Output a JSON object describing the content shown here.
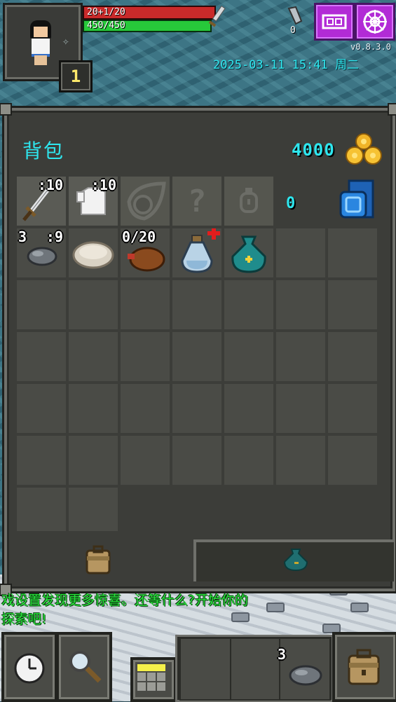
{
  "hud": {
    "hp_text": "20+1/20",
    "hp_fraction": 1.0,
    "exp_text": "450/450",
    "exp_fraction": 1.0,
    "level": "1",
    "keys": "0",
    "version": "v0.8.3.0",
    "datetime": "2025-03-11 15:41 周二",
    "icons": [
      "hero-portrait",
      "sword-icon",
      "key-icon",
      "journal-icon",
      "settings-icon"
    ],
    "colors": {
      "hp": "#c92a2a",
      "exp": "#27c93a",
      "accent": "#2ee6ee",
      "menu_button": "#b22bd6"
    }
  },
  "backpack": {
    "title": "背包",
    "gold": "4000",
    "equipment": [
      {
        "name": "sword-icon",
        "count": ":10"
      },
      {
        "name": "cloth-armor-icon",
        "count": ":10"
      },
      {
        "name": "empty-artifact-slot-icon",
        "count": ""
      },
      {
        "name": "empty-misc-slot-icon",
        "count": ""
      },
      {
        "name": "empty-ring-slot-icon",
        "count": ""
      }
    ],
    "special_count": "0",
    "items": [
      {
        "name": "stones-icon",
        "left_count": "3",
        "count": ":9"
      },
      {
        "name": "pasty-icon",
        "left_count": "",
        "count": ""
      },
      {
        "name": "waterskin-icon",
        "left_count": "",
        "count": "0/20"
      },
      {
        "name": "healing-potion-icon",
        "left_count": "",
        "count": ""
      },
      {
        "name": "seed-pouch-icon",
        "left_count": "",
        "count": ""
      }
    ]
  },
  "chat": {
    "lines": [
      "戏设置发现更多惊喜。还等什么?开始你的",
      "探索吧!"
    ]
  },
  "toolbar": {
    "wait": "wait-clock-icon",
    "search": "search-magnifier-icon",
    "quickslot_count": "3"
  }
}
